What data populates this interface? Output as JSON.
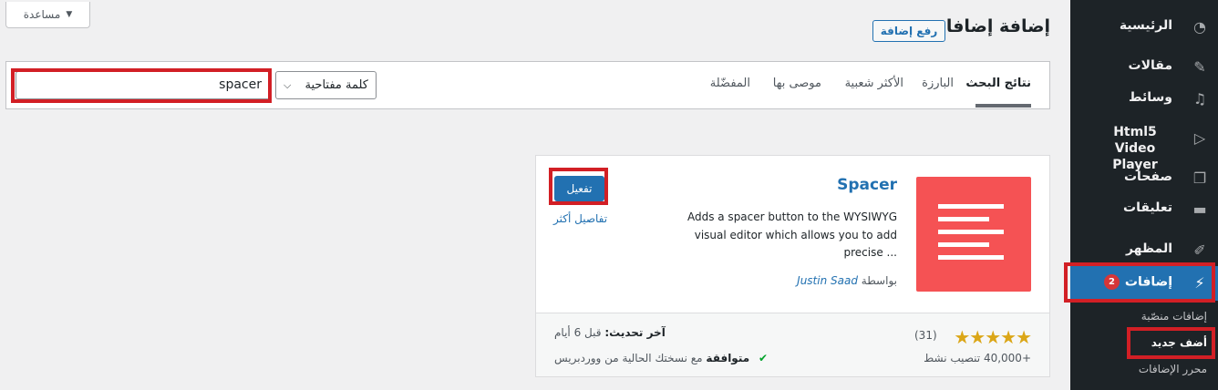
{
  "help": {
    "label": "مساعدة"
  },
  "header": {
    "title": "إضافة إضافات",
    "upload_label": "رفع إضافة"
  },
  "filter": {
    "tabs": [
      {
        "label": "نتائج البحث"
      },
      {
        "label": "البارزة"
      },
      {
        "label": "الأكثر شعبية"
      },
      {
        "label": "موصى بها"
      },
      {
        "label": "المفضّلة"
      }
    ],
    "search_type": "كلمة مفتاحية",
    "search_value": "spacer"
  },
  "plugin": {
    "name": "Spacer",
    "description": "Adds a spacer button to the WYSIWYG visual editor which allows you to add precise ...",
    "author_prefix": "بواسطة",
    "author": "Justin Saad",
    "activate_label": "تفعيل",
    "more_details_label": "تفاصيل أكثر",
    "rating": 5,
    "rating_count": "(31)",
    "installs": "+40,000 تنصيب نشط",
    "last_updated_label": "آخر تحديث:",
    "last_updated_value": "قبل 6 أيام",
    "compat_bold": "متوافقة",
    "compat_rest": "مع نسختك الحالية من ووردبريس",
    "icon_color": "#f55254"
  },
  "sidebar": {
    "items": [
      {
        "label": "الرئيسية",
        "icon": "dashboard-icon"
      },
      {
        "label": "مقالات",
        "icon": "pin-icon"
      },
      {
        "label": "وسائط",
        "icon": "media-icon"
      },
      {
        "label": "Html5 Video Player",
        "icon": "play-icon"
      },
      {
        "label": "صفحات",
        "icon": "pages-icon"
      },
      {
        "label": "تعليقات",
        "icon": "comments-icon"
      },
      {
        "label": "المظهر",
        "icon": "brush-icon"
      },
      {
        "label": "إضافات",
        "icon": "plugin-icon",
        "badge": "2"
      }
    ],
    "submenu": [
      {
        "label": "إضافات منصّبة"
      },
      {
        "label": "أضف جديد"
      },
      {
        "label": "محرر الإضافات"
      }
    ]
  },
  "colors": {
    "accent": "#2271b1",
    "sidebar_bg": "#1d2327",
    "highlight": "#d21f25",
    "star": "#dba617"
  }
}
